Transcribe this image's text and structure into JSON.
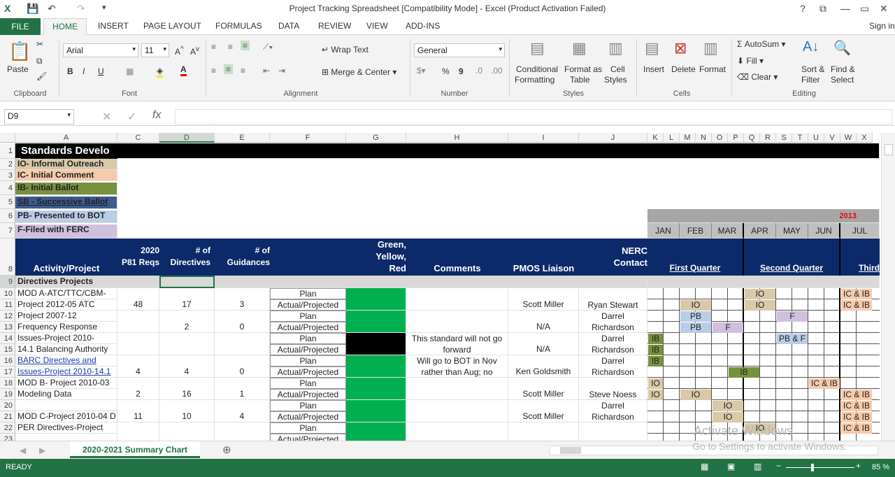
{
  "window": {
    "title": "Project Tracking Spreadsheet  [Compatibility Mode] - Excel (Product Activation Failed)",
    "help": "?",
    "restore": "▭",
    "minimize": "—",
    "close": "✕"
  },
  "tabs": [
    "FILE",
    "HOME",
    "INSERT",
    "PAGE LAYOUT",
    "FORMULAS",
    "DATA",
    "REVIEW",
    "VIEW",
    "ADD-INS"
  ],
  "signin": "Sign in",
  "ribbon": {
    "clipboard": {
      "paste": "Paste",
      "group": "Clipboard"
    },
    "font": {
      "name": "Arial",
      "size": "11",
      "bold": "B",
      "italic": "I",
      "underline": "U",
      "group": "Font"
    },
    "alignment": {
      "wrap": "Wrap Text",
      "merge": "Merge & Center",
      "group": "Alignment"
    },
    "number": {
      "format": "General",
      "percent": "%",
      "comma": "9",
      "group": "Number"
    },
    "styles": {
      "cond1": "Conditional",
      "cond2": "Formatting",
      "fmt1": "Format as",
      "fmt2": "Table",
      "cell1": "Cell",
      "cell2": "Styles",
      "group": "Styles"
    },
    "cells": {
      "insert": "Insert",
      "delete": "Delete",
      "format": "Format",
      "group": "Cells"
    },
    "editing": {
      "autosum": "AutoSum",
      "fill": "Fill",
      "clear": "Clear",
      "sort1": "Sort &",
      "sort2": "Filter",
      "find1": "Find &",
      "find2": "Select",
      "group": "Editing"
    }
  },
  "namebox": "D9",
  "fx": "fx",
  "columns": [
    "A",
    "C",
    "D",
    "E",
    "F",
    "G",
    "H",
    "I",
    "J",
    "K",
    "L",
    "M",
    "N",
    "O",
    "P",
    "Q",
    "R",
    "S",
    "T",
    "U",
    "V",
    "W",
    "X"
  ],
  "rows": [
    "1",
    "2",
    "3",
    "4",
    "5",
    "6",
    "7",
    "8",
    "9",
    "10",
    "11",
    "12",
    "13",
    "14",
    "15",
    "16",
    "17",
    "18",
    "19",
    "20",
    "21",
    "22",
    "23"
  ],
  "title": "Standards Develo",
  "legend": [
    {
      "text": "IO- Informal Outreach",
      "color": "#d9c9a8"
    },
    {
      "text": "IC- Initial Comment",
      "color": "#f6caac"
    },
    {
      "text": "IB- Initial Ballot",
      "color": "#77913f"
    },
    {
      "text": "SB - Successive Ballot",
      "color": "#3c5b8f"
    },
    {
      "text": "PB- Presented to BOT",
      "color": "#b9cde6"
    },
    {
      "text": "F-Filed with FERC",
      "color": "#cfc0dd"
    }
  ],
  "year": "2013",
  "months": [
    "JAN",
    "FEB",
    "MAR",
    "APR",
    "MAY",
    "JUN",
    "JUL"
  ],
  "headers": {
    "activity": "Activity/Project",
    "p81a": "2020",
    "p81b": "P81 Reqs",
    "dir1": "# of",
    "dir2": "Directives",
    "guid1": "# of",
    "guid2": "Guidances",
    "gyr1": "Green,",
    "gyr2": "Yellow,",
    "gyr3": "Red",
    "comments": "Comments",
    "pmos": "PMOS Liaison",
    "nerc1": "NERC",
    "nerc2": "Contact",
    "q1": "First Quarter",
    "q2": "Second Quarter",
    "q3": "Third"
  },
  "section": "Directives Projects",
  "plan": "Plan",
  "actual": "Actual/Projected",
  "projects": [
    {
      "a1": "MOD A-ATC/TTC/CBM-",
      "a2": "Project 2012-05 ATC",
      "c": "48",
      "d": "17",
      "e": "3",
      "h1": "",
      "h2": "",
      "i": "Scott Miller",
      "j1": "",
      "j2": "Ryan Stewart"
    },
    {
      "a1": "Project 2007-12",
      "a2": "Frequency Response",
      "c": "",
      "d": "2",
      "e": "0",
      "h1": "",
      "h2": "",
      "i": "N/A",
      "j1": "Darrel",
      "j2": "Richardson"
    },
    {
      "a1": "Issues-Project 2010-",
      "a2": "14.1 Balancing Authority",
      "c": "",
      "d": "",
      "e": "",
      "h1": "This standard will not go",
      "h2": "forward",
      "i": "N/A",
      "j1": "Darrel",
      "j2": "Richardson"
    },
    {
      "a1": "BARC Directives and",
      "a2": "Issues-Project 2010-14.1",
      "c": "4",
      "d": "4",
      "e": "0",
      "h1": "Will go to BOT in Nov",
      "h2": "rather than Aug; no",
      "i": "Ken Goldsmith",
      "j1": "Darrel",
      "j2": "Richardson"
    },
    {
      "a1": "MOD B- Project 2010-03",
      "a2": "Modeling Data",
      "c": "2",
      "d": "16",
      "e": "1",
      "h1": "",
      "h2": "",
      "i": "Scott Miller",
      "j1": "",
      "j2": "Steve Noess"
    },
    {
      "a1": "",
      "a2": "MOD C-Project 2010-04 D",
      "c": "11",
      "d": "10",
      "e": "4",
      "h1": "",
      "h2": "",
      "i": "Scott Miller",
      "j1": "Darrel",
      "j2": "Richardson"
    },
    {
      "a1": "PER Directives-Project",
      "a2": "",
      "c": "",
      "d": "",
      "e": "",
      "h1": "",
      "h2": "",
      "i": "",
      "j1": "",
      "j2": ""
    }
  ],
  "tags": {
    "io": "IO",
    "ib": "IB",
    "pb": "PB",
    "f": "F",
    "pbf": "PB & F",
    "icib": "IC & IB"
  },
  "sheet": "2020-2021 Summary Chart",
  "watermark1": "Activate Windows",
  "watermark2": "Go to Settings to activate Windows.",
  "status": {
    "ready": "READY",
    "zoom": "85 %"
  }
}
